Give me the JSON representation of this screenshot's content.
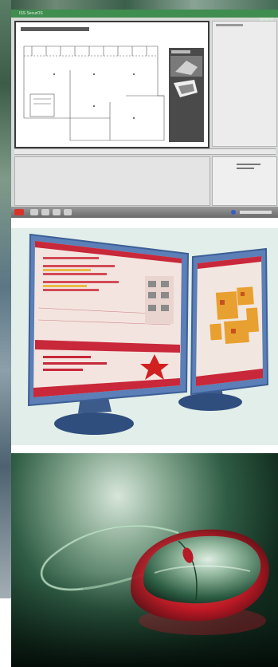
{
  "collage": {
    "panels": [
      {
        "subject": "software-screenshot"
      },
      {
        "subject": "dual-monitors"
      },
      {
        "subject": "computer-mouse"
      }
    ]
  },
  "software": {
    "window_title": "ISS SecurOS"
  },
  "colors": {
    "window_titlebar": "#3f8d4f",
    "monitor_frame": "#5b7fb6",
    "app_accent_red": "#c8283a",
    "mouse_glow_red": "#e0202c",
    "mouse_background": "#0e2a1c"
  }
}
